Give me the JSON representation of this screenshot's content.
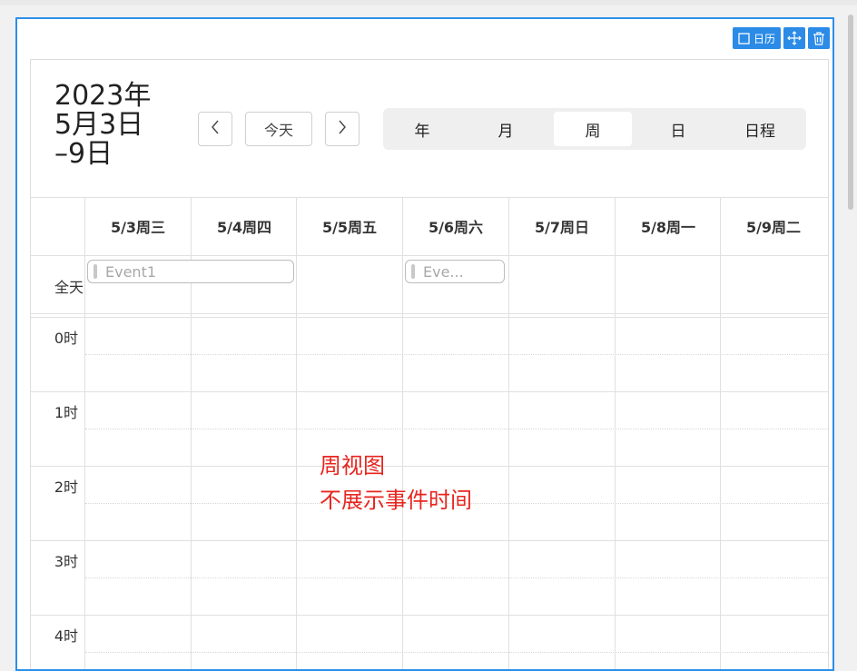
{
  "toolbar": {
    "calendar_label": "日历",
    "icons": [
      "calendar-icon",
      "move-icon",
      "trash-icon"
    ],
    "accent": "#2b8be7"
  },
  "calendar": {
    "title": "2023年\n5月3日\n–9日",
    "today_label": "今天",
    "prev_icon": "chevron-left-icon",
    "next_icon": "chevron-right-icon",
    "views": [
      "年",
      "月",
      "周",
      "日",
      "日程"
    ],
    "active_view": "周",
    "days": [
      "5/3周三",
      "5/4周四",
      "5/5周五",
      "5/6周六",
      "5/7周日",
      "5/8周一",
      "5/9周二"
    ],
    "all_day_label": "全天",
    "all_day_events": [
      {
        "label": "Event1",
        "start_day": "5/3周三",
        "end_day": "5/4周四"
      },
      {
        "label": "Eve...",
        "start_day": "5/6周六",
        "end_day": "5/6周六"
      }
    ],
    "hours": [
      "0时",
      "1时",
      "2时",
      "3时",
      "4时"
    ]
  },
  "annotation": {
    "line1": "周视图",
    "line2": "不展示事件时间",
    "color": "#e8251f"
  }
}
